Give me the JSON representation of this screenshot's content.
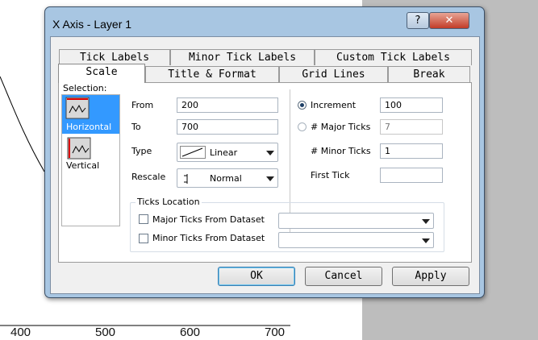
{
  "background": {
    "axis_ticks": [
      "400",
      "500",
      "600",
      "700"
    ]
  },
  "dialog": {
    "title": "X Axis - Layer 1",
    "help_label": "?",
    "close_label": "✕",
    "tabs_back": [
      "Tick Labels",
      "Minor Tick Labels",
      "Custom Tick Labels"
    ],
    "tabs_front": [
      "Scale",
      "Title & Format",
      "Grid Lines",
      "Break"
    ],
    "active_tab": "Scale"
  },
  "scale": {
    "selection_label": "Selection:",
    "selection_items": [
      {
        "label": "Horizontal",
        "icon": "horizontal-axis-icon",
        "selected": true
      },
      {
        "label": "Vertical",
        "icon": "vertical-axis-icon",
        "selected": false
      }
    ],
    "from_label": "From",
    "from_value": "200",
    "to_label": "To",
    "to_value": "700",
    "type_label": "Type",
    "type_value": "Linear",
    "rescale_label": "Rescale",
    "rescale_value": "Normal",
    "increment_label": "Increment",
    "increment_value": "100",
    "increment_selected": true,
    "major_ticks_label": "# Major Ticks",
    "major_ticks_value": "7",
    "minor_ticks_label": "# Minor Ticks",
    "minor_ticks_value": "1",
    "first_tick_label": "First Tick",
    "first_tick_value": ""
  },
  "ticks_location": {
    "title": "Ticks Location",
    "major_label": "Major Ticks From Dataset",
    "minor_label": "Minor Ticks From Dataset"
  },
  "buttons": {
    "ok": "OK",
    "cancel": "Cancel",
    "apply": "Apply"
  },
  "colors": {
    "selection_highlight": "#3399ff",
    "dialog_frame": "#a8c6e2"
  }
}
